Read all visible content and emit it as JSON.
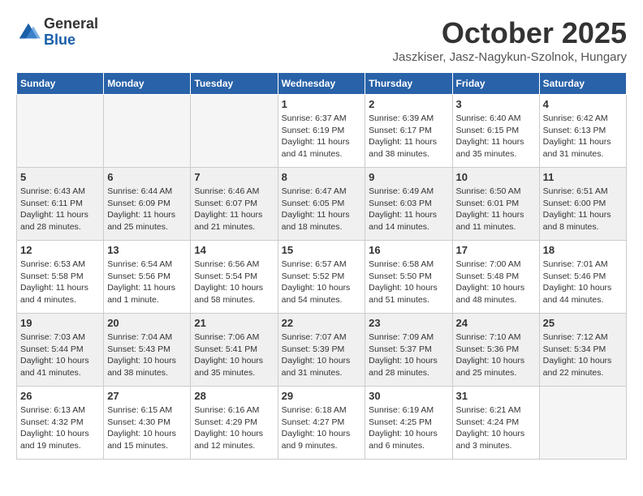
{
  "header": {
    "logo_line1": "General",
    "logo_line2": "Blue",
    "month_title": "October 2025",
    "subtitle": "Jaszkiser, Jasz-Nagykun-Szolnok, Hungary"
  },
  "days_of_week": [
    "Sunday",
    "Monday",
    "Tuesday",
    "Wednesday",
    "Thursday",
    "Friday",
    "Saturday"
  ],
  "weeks": [
    [
      {
        "day": "",
        "info": ""
      },
      {
        "day": "",
        "info": ""
      },
      {
        "day": "",
        "info": ""
      },
      {
        "day": "1",
        "info": "Sunrise: 6:37 AM\nSunset: 6:19 PM\nDaylight: 11 hours and 41 minutes."
      },
      {
        "day": "2",
        "info": "Sunrise: 6:39 AM\nSunset: 6:17 PM\nDaylight: 11 hours and 38 minutes."
      },
      {
        "day": "3",
        "info": "Sunrise: 6:40 AM\nSunset: 6:15 PM\nDaylight: 11 hours and 35 minutes."
      },
      {
        "day": "4",
        "info": "Sunrise: 6:42 AM\nSunset: 6:13 PM\nDaylight: 11 hours and 31 minutes."
      }
    ],
    [
      {
        "day": "5",
        "info": "Sunrise: 6:43 AM\nSunset: 6:11 PM\nDaylight: 11 hours and 28 minutes."
      },
      {
        "day": "6",
        "info": "Sunrise: 6:44 AM\nSunset: 6:09 PM\nDaylight: 11 hours and 25 minutes."
      },
      {
        "day": "7",
        "info": "Sunrise: 6:46 AM\nSunset: 6:07 PM\nDaylight: 11 hours and 21 minutes."
      },
      {
        "day": "8",
        "info": "Sunrise: 6:47 AM\nSunset: 6:05 PM\nDaylight: 11 hours and 18 minutes."
      },
      {
        "day": "9",
        "info": "Sunrise: 6:49 AM\nSunset: 6:03 PM\nDaylight: 11 hours and 14 minutes."
      },
      {
        "day": "10",
        "info": "Sunrise: 6:50 AM\nSunset: 6:01 PM\nDaylight: 11 hours and 11 minutes."
      },
      {
        "day": "11",
        "info": "Sunrise: 6:51 AM\nSunset: 6:00 PM\nDaylight: 11 hours and 8 minutes."
      }
    ],
    [
      {
        "day": "12",
        "info": "Sunrise: 6:53 AM\nSunset: 5:58 PM\nDaylight: 11 hours and 4 minutes."
      },
      {
        "day": "13",
        "info": "Sunrise: 6:54 AM\nSunset: 5:56 PM\nDaylight: 11 hours and 1 minute."
      },
      {
        "day": "14",
        "info": "Sunrise: 6:56 AM\nSunset: 5:54 PM\nDaylight: 10 hours and 58 minutes."
      },
      {
        "day": "15",
        "info": "Sunrise: 6:57 AM\nSunset: 5:52 PM\nDaylight: 10 hours and 54 minutes."
      },
      {
        "day": "16",
        "info": "Sunrise: 6:58 AM\nSunset: 5:50 PM\nDaylight: 10 hours and 51 minutes."
      },
      {
        "day": "17",
        "info": "Sunrise: 7:00 AM\nSunset: 5:48 PM\nDaylight: 10 hours and 48 minutes."
      },
      {
        "day": "18",
        "info": "Sunrise: 7:01 AM\nSunset: 5:46 PM\nDaylight: 10 hours and 44 minutes."
      }
    ],
    [
      {
        "day": "19",
        "info": "Sunrise: 7:03 AM\nSunset: 5:44 PM\nDaylight: 10 hours and 41 minutes."
      },
      {
        "day": "20",
        "info": "Sunrise: 7:04 AM\nSunset: 5:43 PM\nDaylight: 10 hours and 38 minutes."
      },
      {
        "day": "21",
        "info": "Sunrise: 7:06 AM\nSunset: 5:41 PM\nDaylight: 10 hours and 35 minutes."
      },
      {
        "day": "22",
        "info": "Sunrise: 7:07 AM\nSunset: 5:39 PM\nDaylight: 10 hours and 31 minutes."
      },
      {
        "day": "23",
        "info": "Sunrise: 7:09 AM\nSunset: 5:37 PM\nDaylight: 10 hours and 28 minutes."
      },
      {
        "day": "24",
        "info": "Sunrise: 7:10 AM\nSunset: 5:36 PM\nDaylight: 10 hours and 25 minutes."
      },
      {
        "day": "25",
        "info": "Sunrise: 7:12 AM\nSunset: 5:34 PM\nDaylight: 10 hours and 22 minutes."
      }
    ],
    [
      {
        "day": "26",
        "info": "Sunrise: 6:13 AM\nSunset: 4:32 PM\nDaylight: 10 hours and 19 minutes."
      },
      {
        "day": "27",
        "info": "Sunrise: 6:15 AM\nSunset: 4:30 PM\nDaylight: 10 hours and 15 minutes."
      },
      {
        "day": "28",
        "info": "Sunrise: 6:16 AM\nSunset: 4:29 PM\nDaylight: 10 hours and 12 minutes."
      },
      {
        "day": "29",
        "info": "Sunrise: 6:18 AM\nSunset: 4:27 PM\nDaylight: 10 hours and 9 minutes."
      },
      {
        "day": "30",
        "info": "Sunrise: 6:19 AM\nSunset: 4:25 PM\nDaylight: 10 hours and 6 minutes."
      },
      {
        "day": "31",
        "info": "Sunrise: 6:21 AM\nSunset: 4:24 PM\nDaylight: 10 hours and 3 minutes."
      },
      {
        "day": "",
        "info": ""
      }
    ]
  ]
}
